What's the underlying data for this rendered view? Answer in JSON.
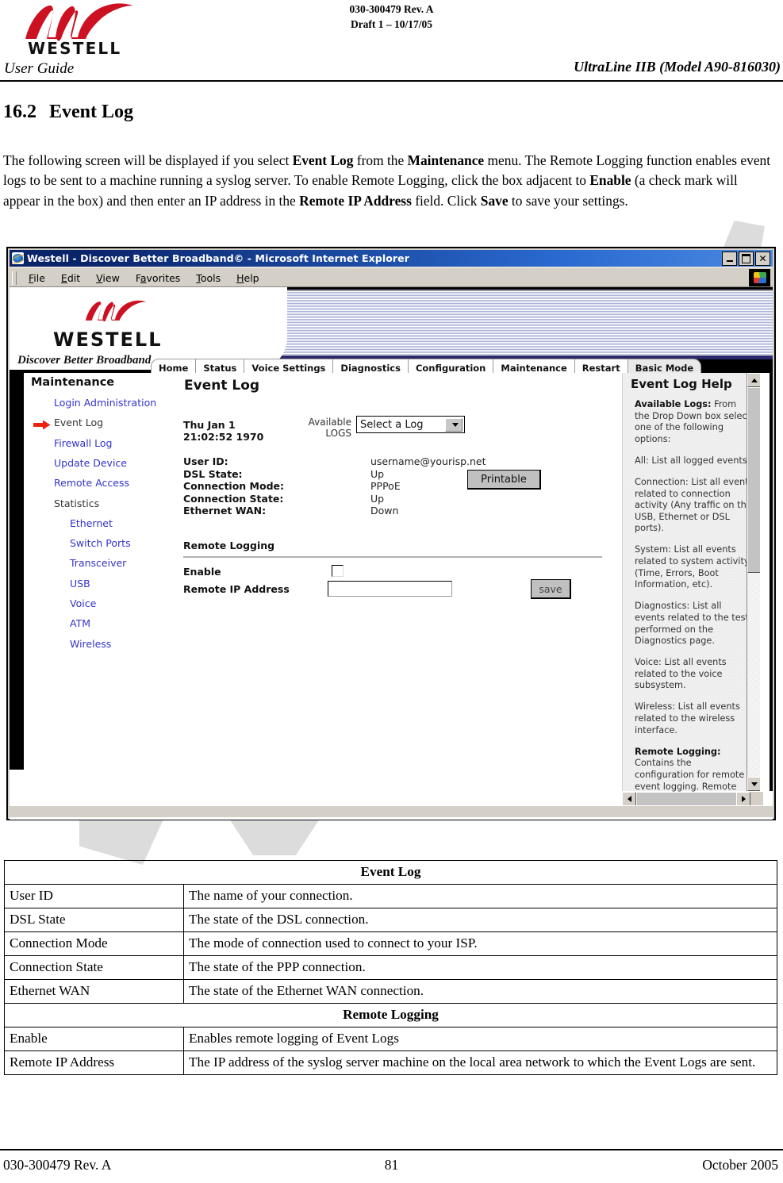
{
  "doc_header": {
    "rev_line1": "030-300479 Rev. A",
    "rev_line2": "Draft 1 – 10/17/05",
    "brand": "WESTELL",
    "left_label": "User Guide",
    "right_label": "UltraLine IIB (Model A90-816030)"
  },
  "section": {
    "number": "16.2",
    "title": "Event Log",
    "paragraph_html": "The following screen will be displayed if you select <b>Event Log</b> from the <b>Maintenance</b> menu. The Remote Logging function enables event logs to be sent to a machine running a syslog server. To enable Remote Logging, click the box adjacent to <b>Enable</b> (a check mark will appear in the box) and then enter an IP address in the <b>Remote IP Address</b> field. Click <b>Save</b> to save your settings."
  },
  "browser": {
    "title": "Westell - Discover Better Broadband© - Microsoft Internet Explorer",
    "menu": [
      "File",
      "Edit",
      "View",
      "Favorites",
      "Tools",
      "Help"
    ],
    "window_buttons": [
      "minimize",
      "maximize",
      "close"
    ]
  },
  "site": {
    "brand_name": "WESTELL",
    "tagline": "Discover Better Broadband",
    "nav_tabs": [
      "Home",
      "Status",
      "Voice Settings",
      "Diagnostics",
      "Configuration",
      "Maintenance",
      "Restart",
      "Basic Mode"
    ]
  },
  "sidebar": {
    "title": "Maintenance",
    "items": [
      {
        "label": "Login Administration",
        "selected": false,
        "indent": 0
      },
      {
        "label": "Event Log",
        "selected": true,
        "indent": 0
      },
      {
        "label": "Firewall Log",
        "selected": false,
        "indent": 0
      },
      {
        "label": "Update Device",
        "selected": false,
        "indent": 0
      },
      {
        "label": "Remote Access",
        "selected": false,
        "indent": 0
      },
      {
        "label": "Statistics",
        "selected": false,
        "indent": 0,
        "plain": true
      },
      {
        "label": "Ethernet",
        "selected": false,
        "indent": 1
      },
      {
        "label": "Switch Ports",
        "selected": false,
        "indent": 1
      },
      {
        "label": "Transceiver",
        "selected": false,
        "indent": 1
      },
      {
        "label": "USB",
        "selected": false,
        "indent": 1
      },
      {
        "label": "Voice",
        "selected": false,
        "indent": 1
      },
      {
        "label": "ATM",
        "selected": false,
        "indent": 1
      },
      {
        "label": "Wireless",
        "selected": false,
        "indent": 1
      }
    ]
  },
  "content": {
    "title": "Event Log",
    "date_line1": "Thu Jan 1",
    "date_line2": "21:02:52 1970",
    "available_line1": "Available",
    "available_line2": "LOGS",
    "log_select_value": "Select a Log",
    "fields": [
      {
        "label": "User ID:",
        "value": "username@yourisp.net"
      },
      {
        "label": "DSL State:",
        "value": "Up"
      },
      {
        "label": "Connection Mode:",
        "value": "PPPoE"
      },
      {
        "label": "Connection State:",
        "value": "Up"
      },
      {
        "label": "Ethernet WAN:",
        "value": "Down"
      }
    ],
    "printable_label": "Printable",
    "remote_logging": {
      "heading": "Remote Logging",
      "enable_label": "Enable",
      "enable_checked": false,
      "ip_label": "Remote IP Address",
      "ip_value": "",
      "save_label": "save"
    }
  },
  "help": {
    "title": "Event Log Help",
    "paragraphs": [
      {
        "bold": "Available Logs:",
        "text": " From the Drop Down box select one of the following options:"
      },
      {
        "bold": "",
        "text": "All: List all logged events"
      },
      {
        "bold": "",
        "text": "Connection: List all events related to connection activity (Any traffic on the USB, Ethernet or DSL ports)."
      },
      {
        "bold": "",
        "text": "System: List all events related to system activity (Time, Errors, Boot Information, etc)."
      },
      {
        "bold": "",
        "text": "Diagnostics: List all events related to the tests performed on the Diagnostics page."
      },
      {
        "bold": "",
        "text": "Voice: List all events related to the voice subsystem."
      },
      {
        "bold": "",
        "text": "Wireless: List all events related to the wireless interface."
      },
      {
        "bold": "Remote Logging:",
        "text": " Contains the configuration for remote event logging. Remote"
      }
    ]
  },
  "reference_table": {
    "section1_header": "Event Log",
    "section1_rows": [
      {
        "key": "User ID",
        "desc": "The name of your connection."
      },
      {
        "key": "DSL State",
        "desc": "The state of the DSL connection."
      },
      {
        "key": "Connection Mode",
        "desc": "The mode of connection used to connect to your ISP."
      },
      {
        "key": "Connection State",
        "desc": "The state of the PPP connection."
      },
      {
        "key": "Ethernet WAN",
        "desc": "The state of the Ethernet WAN connection."
      }
    ],
    "section2_header": "Remote Logging",
    "section2_rows": [
      {
        "key": "Enable",
        "desc": "Enables remote logging of Event Logs"
      },
      {
        "key": "Remote IP Address",
        "desc": "The IP address of the syslog server machine on the local area network to which the Event Logs are sent."
      }
    ]
  },
  "footer": {
    "left": "030-300479 Rev. A",
    "center": "81",
    "right": "October 2005"
  },
  "colors": {
    "brand_red": "#cc1122",
    "link_blue": "#3333cc",
    "title_blue": "#0a246a",
    "chrome_gray": "#d4d0c8"
  }
}
